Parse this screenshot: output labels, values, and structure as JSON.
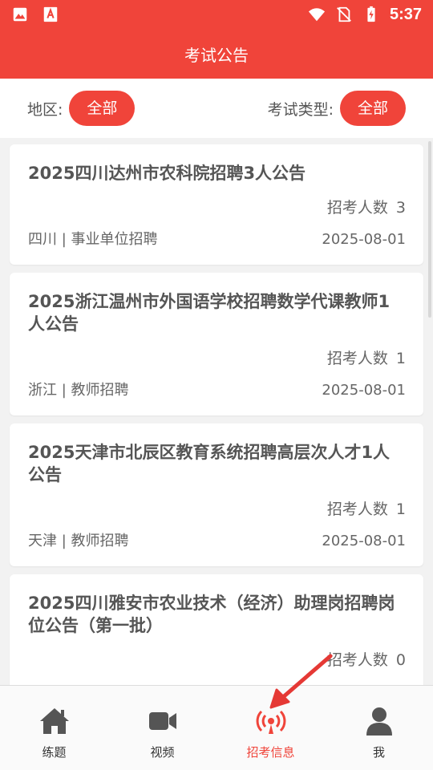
{
  "status_bar": {
    "time": "5:37",
    "icons": [
      "image-icon",
      "pdf-app-icon",
      "wifi-icon",
      "no-sim-icon",
      "battery-charging-icon"
    ]
  },
  "header": {
    "title": "考试公告"
  },
  "filters": {
    "region_label": "地区:",
    "region_value": "全部",
    "type_label": "考试类型:",
    "type_value": "全部"
  },
  "announcements": [
    {
      "title": "2025四川达州市农科院招聘3人公告",
      "count_label": "招考人数",
      "count": "3",
      "meta": "四川 | 事业单位招聘",
      "date": "2025-08-01"
    },
    {
      "title": "2025浙江温州市外国语学校招聘数学代课教师1人公告",
      "count_label": "招考人数",
      "count": "1",
      "meta": "浙江 | 教师招聘",
      "date": "2025-08-01"
    },
    {
      "title": "2025天津市北辰区教育系统招聘高层次人才1人公告",
      "count_label": "招考人数",
      "count": "1",
      "meta": "天津 | 教师招聘",
      "date": "2025-08-01"
    },
    {
      "title": "2025四川雅安市农业技术（经济）助理岗招聘岗位公告（第一批）",
      "count_label": "招考人数",
      "count": "0",
      "meta": "",
      "date": ""
    }
  ],
  "bottom_nav": [
    {
      "label": "练题",
      "icon": "home-icon",
      "active": false
    },
    {
      "label": "视频",
      "icon": "video-camera-icon",
      "active": false
    },
    {
      "label": "招考信息",
      "icon": "broadcast-icon",
      "active": true
    },
    {
      "label": "我",
      "icon": "user-icon",
      "active": false
    }
  ],
  "colors": {
    "accent": "#f0443a",
    "annotation_arrow": "#e53935"
  }
}
